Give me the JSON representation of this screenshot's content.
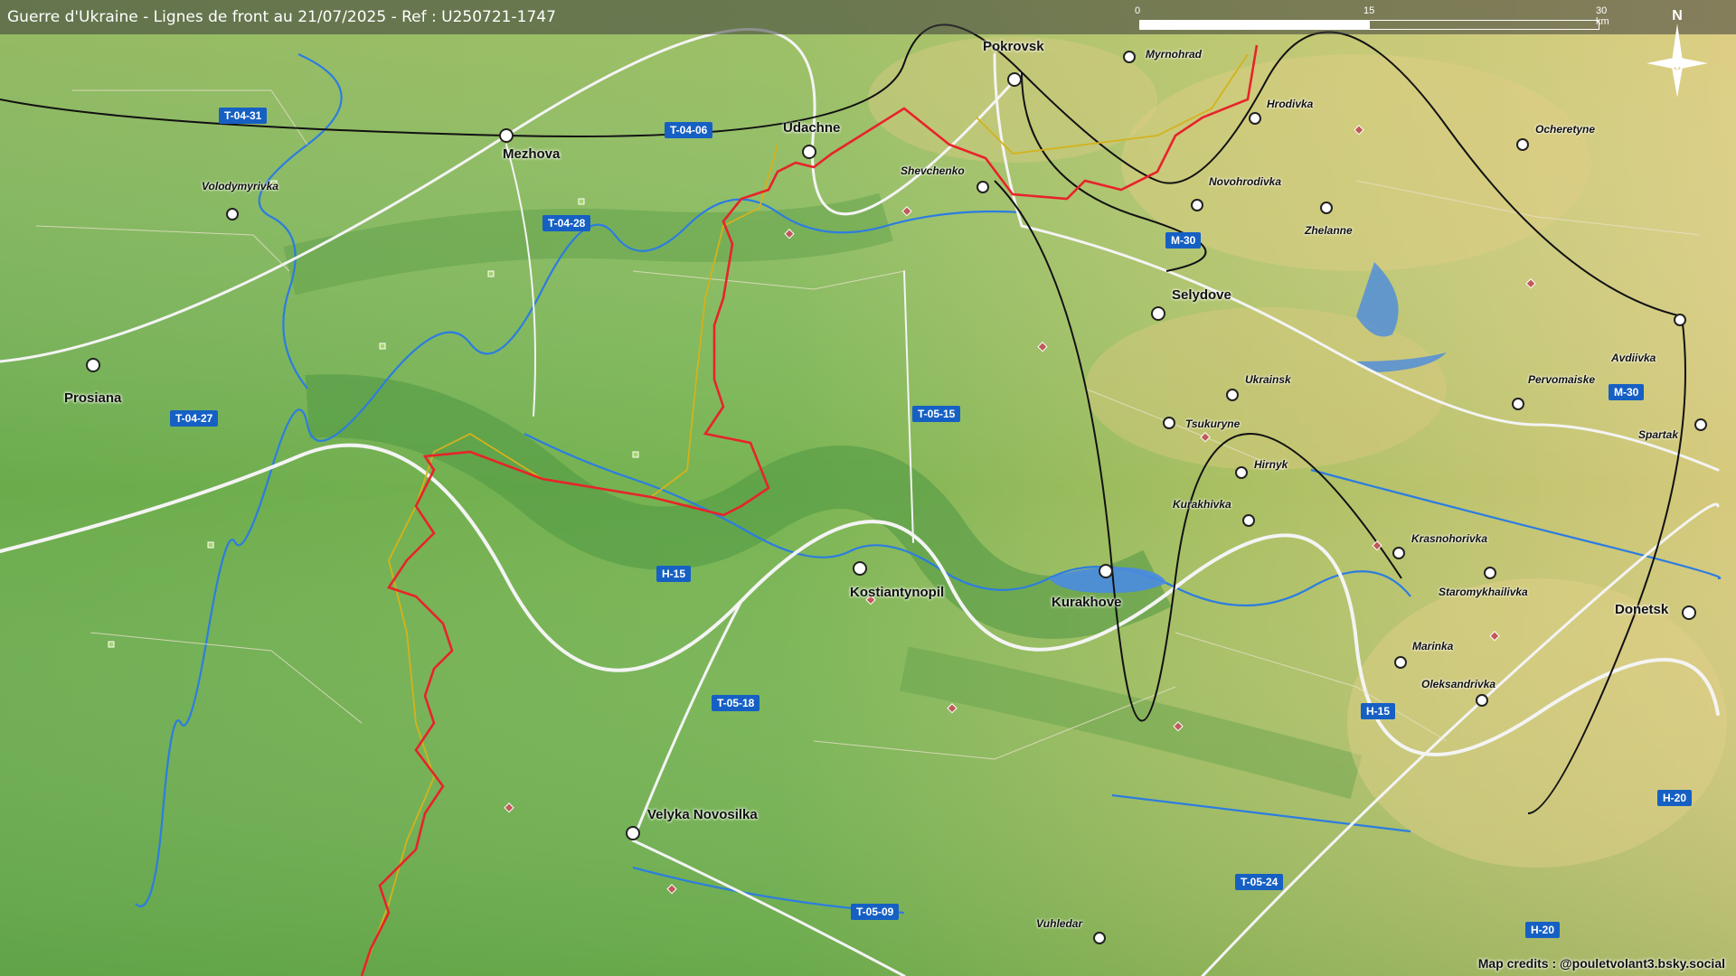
{
  "title": "Guerre d'Ukraine - Lignes de front au 21/07/2025 - Ref : U250721-1747",
  "scale": {
    "labels": [
      "0",
      "15",
      "30 km"
    ]
  },
  "north_label": "N",
  "credits": "Map credits : @pouletvolant3.bsky.social",
  "cities": {
    "pokrovsk": "Pokrovsk",
    "mezhova": "Mezhova",
    "udachne": "Udachne",
    "prosiana": "Prosiana",
    "selydove": "Selydove",
    "kurakhove": "Kurakhove",
    "kostiantynopil": "Kostiantynopil",
    "velyka_novosilka": "Velyka Novosilka",
    "donetsk": "Donetsk"
  },
  "towns": {
    "myrnohrad": "Myrnohrad",
    "hrodivka": "Hrodivka",
    "ocheretyne": "Ocheretyne",
    "novohrodivka": "Novohrodivka",
    "zhelanne": "Zhelanne",
    "volodymyrivka": "Volodymyrivka",
    "shevchenko": "Shevchenko",
    "ukrainsk": "Ukrainsk",
    "tsukuryne": "Tsukuryne",
    "hirnyk": "Hirnyk",
    "kurakhivka": "Kurakhivka",
    "krasnohorivka": "Krasnohorivka",
    "staromykhailivka": "Staromykhailivka",
    "marinka": "Marinka",
    "oleksandrivka": "Oleksandrivka",
    "avdiivka": "Avdiivka",
    "pervomaiske": "Pervomaiske",
    "spartak": "Spartak",
    "vuhledar": "Vuhledar"
  },
  "roads": {
    "t0431": "T-04-31",
    "t0406": "T-04-06",
    "t0428": "T-04-28",
    "t0427": "T-04-27",
    "m30a": "M-30",
    "m30b": "M-30",
    "t0515": "T-05-15",
    "h15a": "H-15",
    "h15b": "H-15",
    "t0518": "T-05-18",
    "h20a": "H-20",
    "h20b": "H-20",
    "t0524": "T-05-24",
    "t0509": "T-05-09"
  },
  "colors": {
    "front_line": "#e8232a",
    "previous_front": "#d4b21c",
    "river": "#2c7de0",
    "road": "#f2f2f2",
    "railway": "#111111",
    "road_badge": "#1660c4"
  }
}
